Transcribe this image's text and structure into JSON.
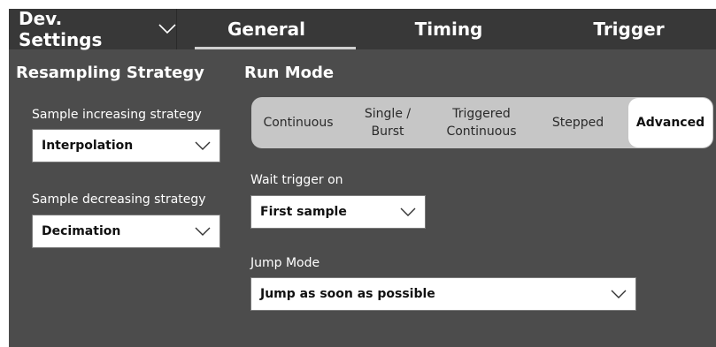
{
  "header": {
    "dev_settings_label": "Dev. Settings",
    "tabs": [
      {
        "label": "General",
        "selected": true
      },
      {
        "label": "Timing",
        "selected": false
      },
      {
        "label": "Trigger",
        "selected": false
      }
    ]
  },
  "resampling": {
    "title": "Resampling Strategy",
    "increasing_label": "Sample increasing strategy",
    "increasing_value": "Interpolation",
    "decreasing_label": "Sample decreasing strategy",
    "decreasing_value": "Decimation"
  },
  "run_mode": {
    "title": "Run Mode",
    "options": [
      {
        "label": "Continuous",
        "selected": false
      },
      {
        "label": "Single /\nBurst",
        "selected": false
      },
      {
        "label": "Triggered\nContinuous",
        "selected": false
      },
      {
        "label": "Stepped",
        "selected": false
      },
      {
        "label": "Advanced",
        "selected": true
      }
    ],
    "wait_trigger_label": "Wait trigger on",
    "wait_trigger_value": "First sample",
    "jump_mode_label": "Jump Mode",
    "jump_mode_value": "Jump as soon as possible"
  },
  "icons": {
    "dropdown": "chevron-down-icon"
  },
  "colors": {
    "panel_bg": "#4c4c4c",
    "tabbar_bg": "#383838",
    "segment_bg": "#c6c6c6",
    "segment_active_bg": "#ffffff"
  }
}
